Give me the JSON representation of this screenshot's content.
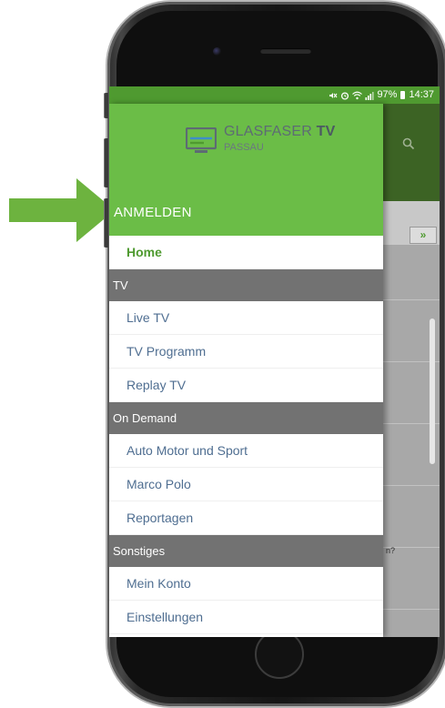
{
  "status_bar": {
    "icons": [
      "mute-icon",
      "alarm-icon",
      "wifi-icon",
      "signal-icon",
      "battery-icon"
    ],
    "battery": "97%",
    "time": "14:37"
  },
  "logo": {
    "brand": "GLASFASER",
    "brand_tv": "TV",
    "subtitle": "PASSAU"
  },
  "drawer": {
    "login_label": "ANMELDEN",
    "home": "Home",
    "sections": [
      {
        "title": "TV",
        "items": [
          "Live TV",
          "TV Programm",
          "Replay TV"
        ]
      },
      {
        "title": "On Demand",
        "items": [
          "Auto Motor und Sport",
          "Marco Polo",
          "Reportagen"
        ]
      },
      {
        "title": "Sonstiges",
        "items": [
          "Mein Konto",
          "Einstellungen"
        ]
      }
    ]
  },
  "background_app": {
    "tab_arrow": "»",
    "peek_text": "n?"
  },
  "colors": {
    "drawer_header": "#6bbd47",
    "status_bar": "#4f9a30",
    "app_header": "#3c6324",
    "section_header": "#727272",
    "menu_text": "#4f6e91",
    "active_text": "#4f9a30",
    "pointer_arrow": "#6db33f"
  }
}
